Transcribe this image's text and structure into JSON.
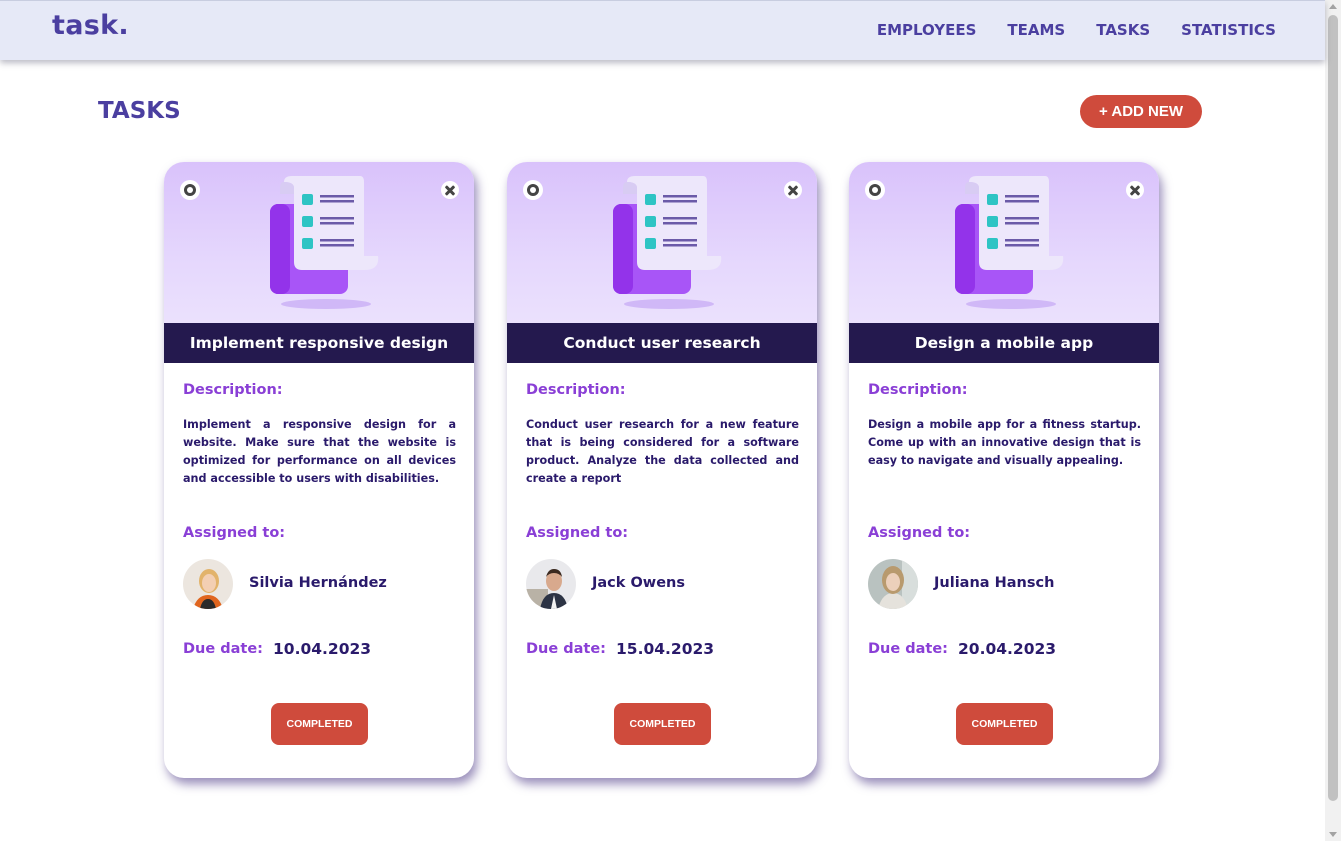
{
  "header": {
    "logo": "task.",
    "nav": [
      "EMPLOYEES",
      "TEAMS",
      "TASKS",
      "STATISTICS"
    ]
  },
  "page": {
    "title": "TASKS",
    "add_button": "+ ADD NEW"
  },
  "labels": {
    "description": "Description:",
    "assigned": "Assigned to:",
    "due": "Due date:"
  },
  "cards": [
    {
      "title": "Implement responsive design",
      "description": "Implement a responsive design for a website. Make sure that the website is optimized for performance on all devices and accessible to users with disabilities.",
      "assignee": "Silvia Hernández",
      "due_date": "10.04.2023",
      "status": "COMPLETED"
    },
    {
      "title": "Conduct user research",
      "description": "Conduct user research for a new feature that is being considered for a software product. Analyze the data collected and create a report",
      "assignee": "Jack Owens",
      "due_date": "15.04.2023",
      "status": "COMPLETED"
    },
    {
      "title": "Design a mobile app",
      "description": "Design a mobile app for a fitness startup. Come up with an innovative design that is easy to navigate and visually appealing.",
      "assignee": "Juliana Hansch",
      "due_date": "20.04.2023",
      "status": "COMPLETED"
    }
  ],
  "colors": {
    "brand": "#4b3fa0",
    "accent": "#cf4b3c",
    "title_bar": "#24194e",
    "label": "#8a3fd6"
  }
}
